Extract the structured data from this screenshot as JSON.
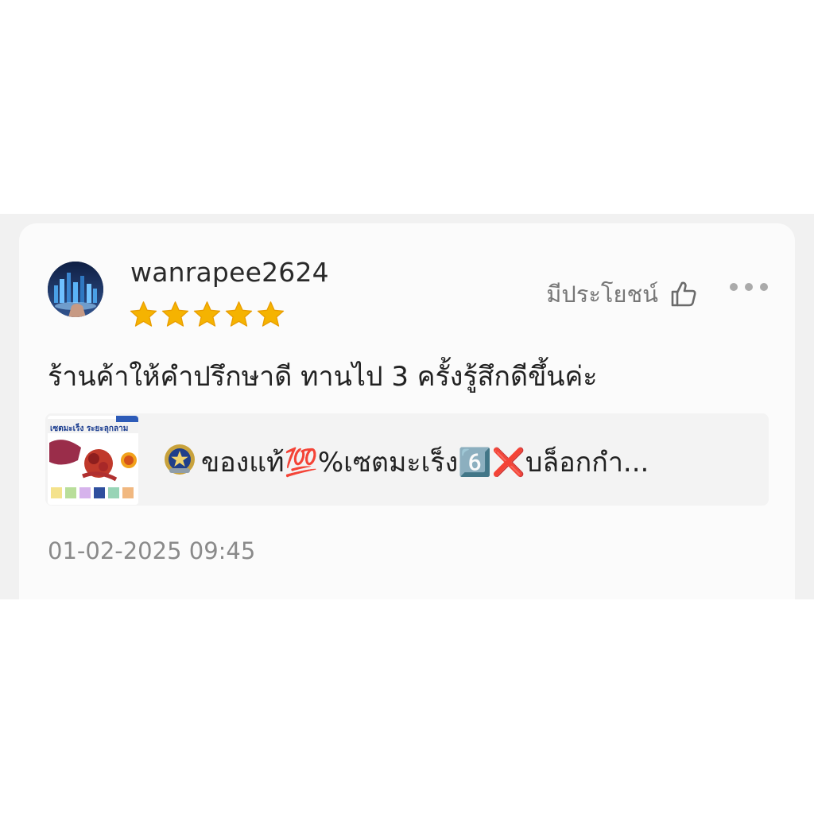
{
  "review": {
    "username": "wanrapee2624",
    "rating": 5,
    "rating_max": 5,
    "helpful_label": "มีประโยชน์",
    "text": "ร้านค้าให้คำปรึกษาดี ทานไป  3 ครั้งรู้สึกดีขึ้นค่ะ",
    "timestamp": "01-02-2025 09:45"
  },
  "product": {
    "title": "ของแท้💯%เซตมะเร็ง6️⃣❌บล็อกกำ...",
    "thumbnail_title": "เซตมะเร็ง ระยะลุกลาม"
  },
  "icons": {
    "helpful": "thumbs-up-icon",
    "more": "more-options-icon",
    "badge": "certified-badge-icon",
    "star": "star-icon"
  },
  "colors": {
    "star": "#f5b301",
    "username": "#2a2a2a",
    "muted": "#8a8a8a",
    "card": "#fbfbfb",
    "band": "#f1f1f1"
  }
}
